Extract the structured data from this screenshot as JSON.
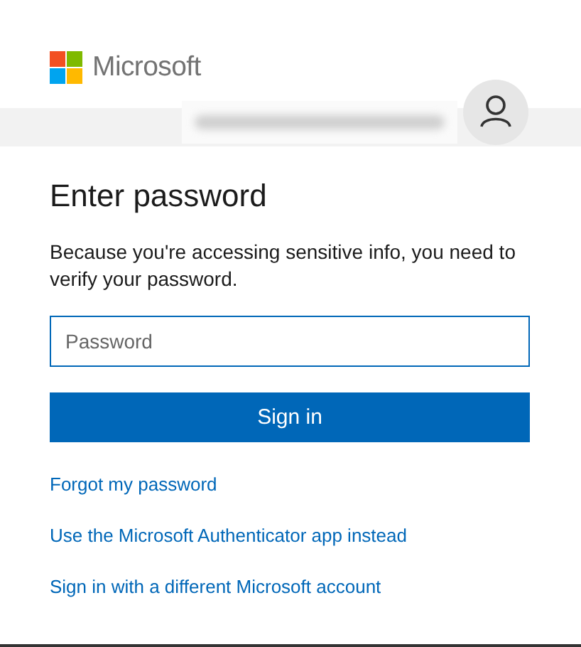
{
  "brand": {
    "name": "Microsoft"
  },
  "title": "Enter password",
  "description": "Because you're accessing sensitive info, you need to verify your password.",
  "password_field": {
    "placeholder": "Password"
  },
  "sign_in_button": "Sign in",
  "links": [
    "Forgot my password",
    "Use the Microsoft Authenticator app instead",
    "Sign in with a different Microsoft account"
  ]
}
